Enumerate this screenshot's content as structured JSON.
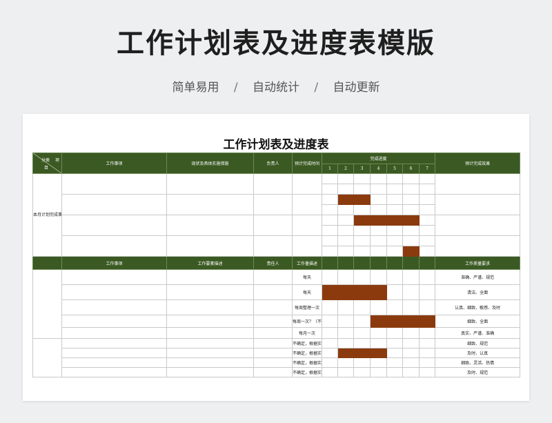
{
  "hero": {
    "title": "工作计划表及进度表模版",
    "tags": [
      "简单易用",
      "自动统计",
      "自动更新"
    ],
    "separator": "/"
  },
  "sheet": {
    "title": "工作计划表及进度表",
    "colors": {
      "header_bg": "#3b5a23",
      "progress_fill": "#8b3a0e",
      "header_text": "#ffffff"
    },
    "header1": {
      "corner_top_left": "分类",
      "corner_top_right": "项",
      "corner_bottom": "目",
      "task": "工作事项",
      "status": "现状及具体实施措施",
      "owner": "负责人",
      "planned_time": "预计完成时间",
      "progress": "完成进度",
      "days": [
        "1",
        "2",
        "3",
        "4",
        "5",
        "6",
        "7"
      ],
      "result": "预计完成效果"
    },
    "section1_label": "本月计划完成事项",
    "section1_rows": [
      {
        "fill": []
      },
      {
        "fill": []
      },
      {
        "fill": [
          2,
          3
        ]
      },
      {
        "fill": []
      },
      {
        "fill": [
          3,
          4,
          5,
          6
        ]
      },
      {
        "fill": []
      },
      {
        "fill": []
      },
      {
        "fill": [
          6
        ]
      }
    ],
    "header2": {
      "task": "工作事项",
      "key_points": "工作要素描述",
      "owner": "责任人",
      "amount": "工作量描述",
      "quality": "工作质量要求"
    },
    "section2_rows": [
      {
        "amount": "每天",
        "fill": [],
        "quality": "准确、严谨、规范"
      },
      {
        "amount": "每天",
        "fill": [
          1,
          2,
          3,
          4
        ],
        "quality": "清洁、全面"
      },
      {
        "amount": "每周整理一次",
        "fill": [],
        "quality": "认真、细致、敏感、及时"
      },
      {
        "amount": "每周一次？（不包括周末）",
        "fill": [
          4,
          5,
          6,
          7
        ],
        "quality": "细致、全面"
      },
      {
        "amount": "每月一次",
        "fill": [],
        "quality": "真实、严谨、准确"
      },
      {
        "amount": "不确定，根据实际需要",
        "fill": [],
        "quality": "细致、规范"
      },
      {
        "amount": "不确定，根据实际需要",
        "fill": [
          2,
          3,
          4
        ],
        "quality": "及时、认真"
      },
      {
        "amount": "不确定，根据实际需要",
        "fill": [],
        "quality": "细致、灵活、热情"
      },
      {
        "amount": "不确定，根据实际需要",
        "fill": [],
        "quality": "及时、规范"
      }
    ]
  }
}
